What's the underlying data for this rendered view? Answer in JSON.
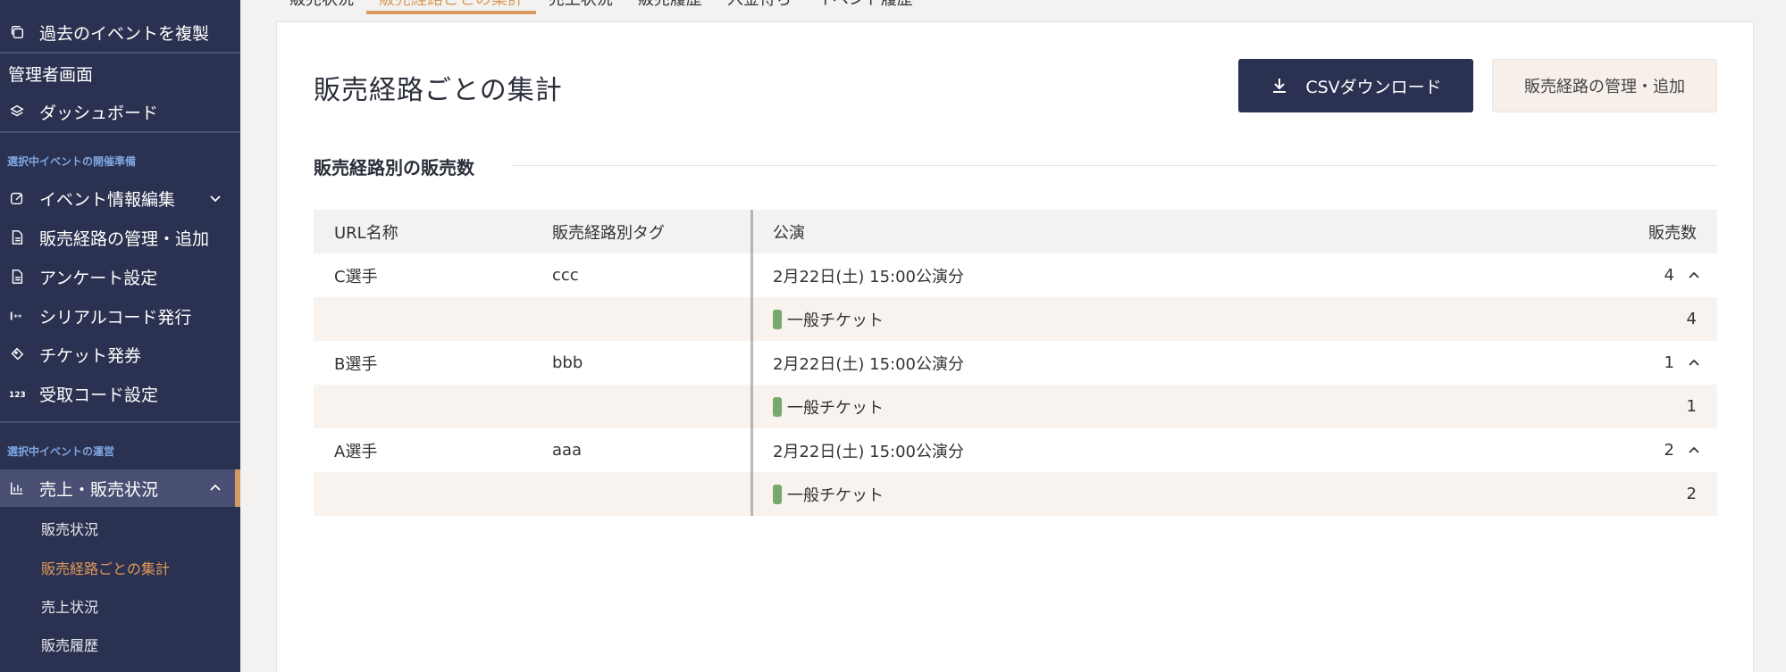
{
  "sidebar": {
    "items_top": [
      {
        "label": "過去のイベントを複製",
        "icon": "copy-icon"
      }
    ],
    "admin_label": "管理者画面",
    "dashboard_label": "ダッシュボード",
    "section_prep": "選択中イベントの開催準備",
    "prep_items": [
      {
        "label": "イベント情報編集",
        "icon": "edit-icon"
      },
      {
        "label": "販売経路の管理・追加",
        "icon": "document-icon"
      },
      {
        "label": "アンケート設定",
        "icon": "document-icon"
      },
      {
        "label": "シリアルコード発行",
        "icon": "serial-code-icon"
      },
      {
        "label": "チケット発券",
        "icon": "ticket-icon"
      },
      {
        "label": "受取コード設定",
        "icon": "number-code-icon"
      }
    ],
    "section_ops": "選択中イベントの運営",
    "ops_active": {
      "label": "売上・販売状況",
      "icon": "bar-chart-icon"
    },
    "ops_sub": [
      "販売状況",
      "販売経路ごとの集計",
      "売上状況",
      "販売履歴"
    ]
  },
  "tabs": [
    "販売状況",
    "販売経路ごとの集計",
    "売上状況",
    "販売履歴",
    "入金待ち",
    "イベント履歴"
  ],
  "page": {
    "title": "販売経路ごとの集計",
    "csv_button": "CSVダウンロード",
    "manage_button": "販売経路の管理・追加",
    "section_title": "販売経路別の販売数"
  },
  "table": {
    "headers": {
      "url": "URL名称",
      "tag": "販売経路別タグ",
      "performance": "公演",
      "count": "販売数"
    },
    "groups": [
      {
        "url": "C選手",
        "tag": "ccc",
        "performance": "2月22日(土) 15:00公演分",
        "count": "4",
        "ticket": "一般チケット",
        "ticket_count": "4"
      },
      {
        "url": "B選手",
        "tag": "bbb",
        "performance": "2月22日(土) 15:00公演分",
        "count": "1",
        "ticket": "一般チケット",
        "ticket_count": "1"
      },
      {
        "url": "A選手",
        "tag": "aaa",
        "performance": "2月22日(土) 15:00公演分",
        "count": "2",
        "ticket": "一般チケット",
        "ticket_count": "2"
      }
    ]
  },
  "colors": {
    "sidebar_bg": "#2b3150",
    "accent": "#d99a5b",
    "badge": "#78a86a"
  }
}
